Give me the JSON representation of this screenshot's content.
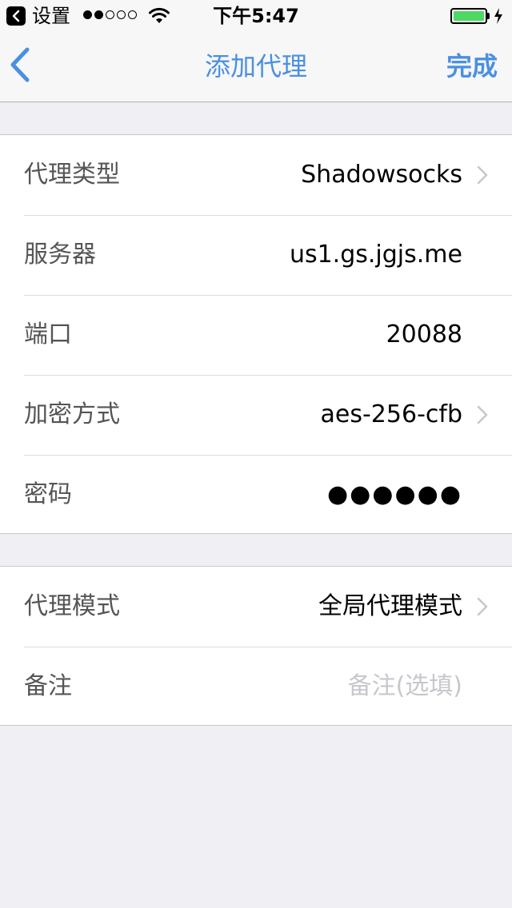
{
  "status_bar": {
    "back_app": "设置",
    "signal_filled": 2,
    "signal_total": 5,
    "time": "下午5:47",
    "battery_level": 1.0
  },
  "nav": {
    "back_icon": "chevron-left-icon",
    "title": "添加代理",
    "done_label": "完成"
  },
  "colors": {
    "accent": "#4a90e2",
    "background": "#efeff4",
    "battery": "#4cd964",
    "placeholder": "#c7c7cd"
  },
  "proxy": {
    "type_label": "代理类型",
    "type_value": "Shadowsocks",
    "server_label": "服务器",
    "server_value": "us1.gs.jgjs.me",
    "port_label": "端口",
    "port_value": "20088",
    "cipher_label": "加密方式",
    "cipher_value": "aes-256-cfb",
    "password_label": "密码",
    "password_value": "●●●●●●"
  },
  "options": {
    "mode_label": "代理模式",
    "mode_value": "全局代理模式",
    "note_label": "备注",
    "note_placeholder": "备注(选填)"
  }
}
